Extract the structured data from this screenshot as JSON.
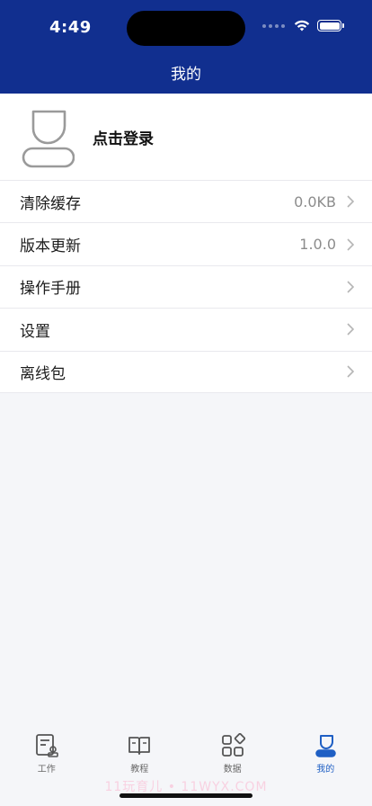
{
  "status_bar": {
    "time": "4:49"
  },
  "nav": {
    "title": "我的"
  },
  "profile": {
    "login_label": "点击登录"
  },
  "menu": [
    {
      "label": "清除缓存",
      "value": "0.0KB"
    },
    {
      "label": "版本更新",
      "value": "1.0.0"
    },
    {
      "label": "操作手册",
      "value": ""
    },
    {
      "label": "设置",
      "value": ""
    },
    {
      "label": "离线包",
      "value": ""
    }
  ],
  "tabs": [
    {
      "label": "工作",
      "icon": "work-icon",
      "active": false
    },
    {
      "label": "教程",
      "icon": "book-icon",
      "active": false
    },
    {
      "label": "数据",
      "icon": "data-icon",
      "active": false
    },
    {
      "label": "我的",
      "icon": "profile-icon",
      "active": true
    }
  ],
  "watermark": "11玩育儿 • 11WYX.COM",
  "colors": {
    "header": "#112f8f",
    "accent": "#1f5fc4",
    "background": "#f5f6f9"
  }
}
